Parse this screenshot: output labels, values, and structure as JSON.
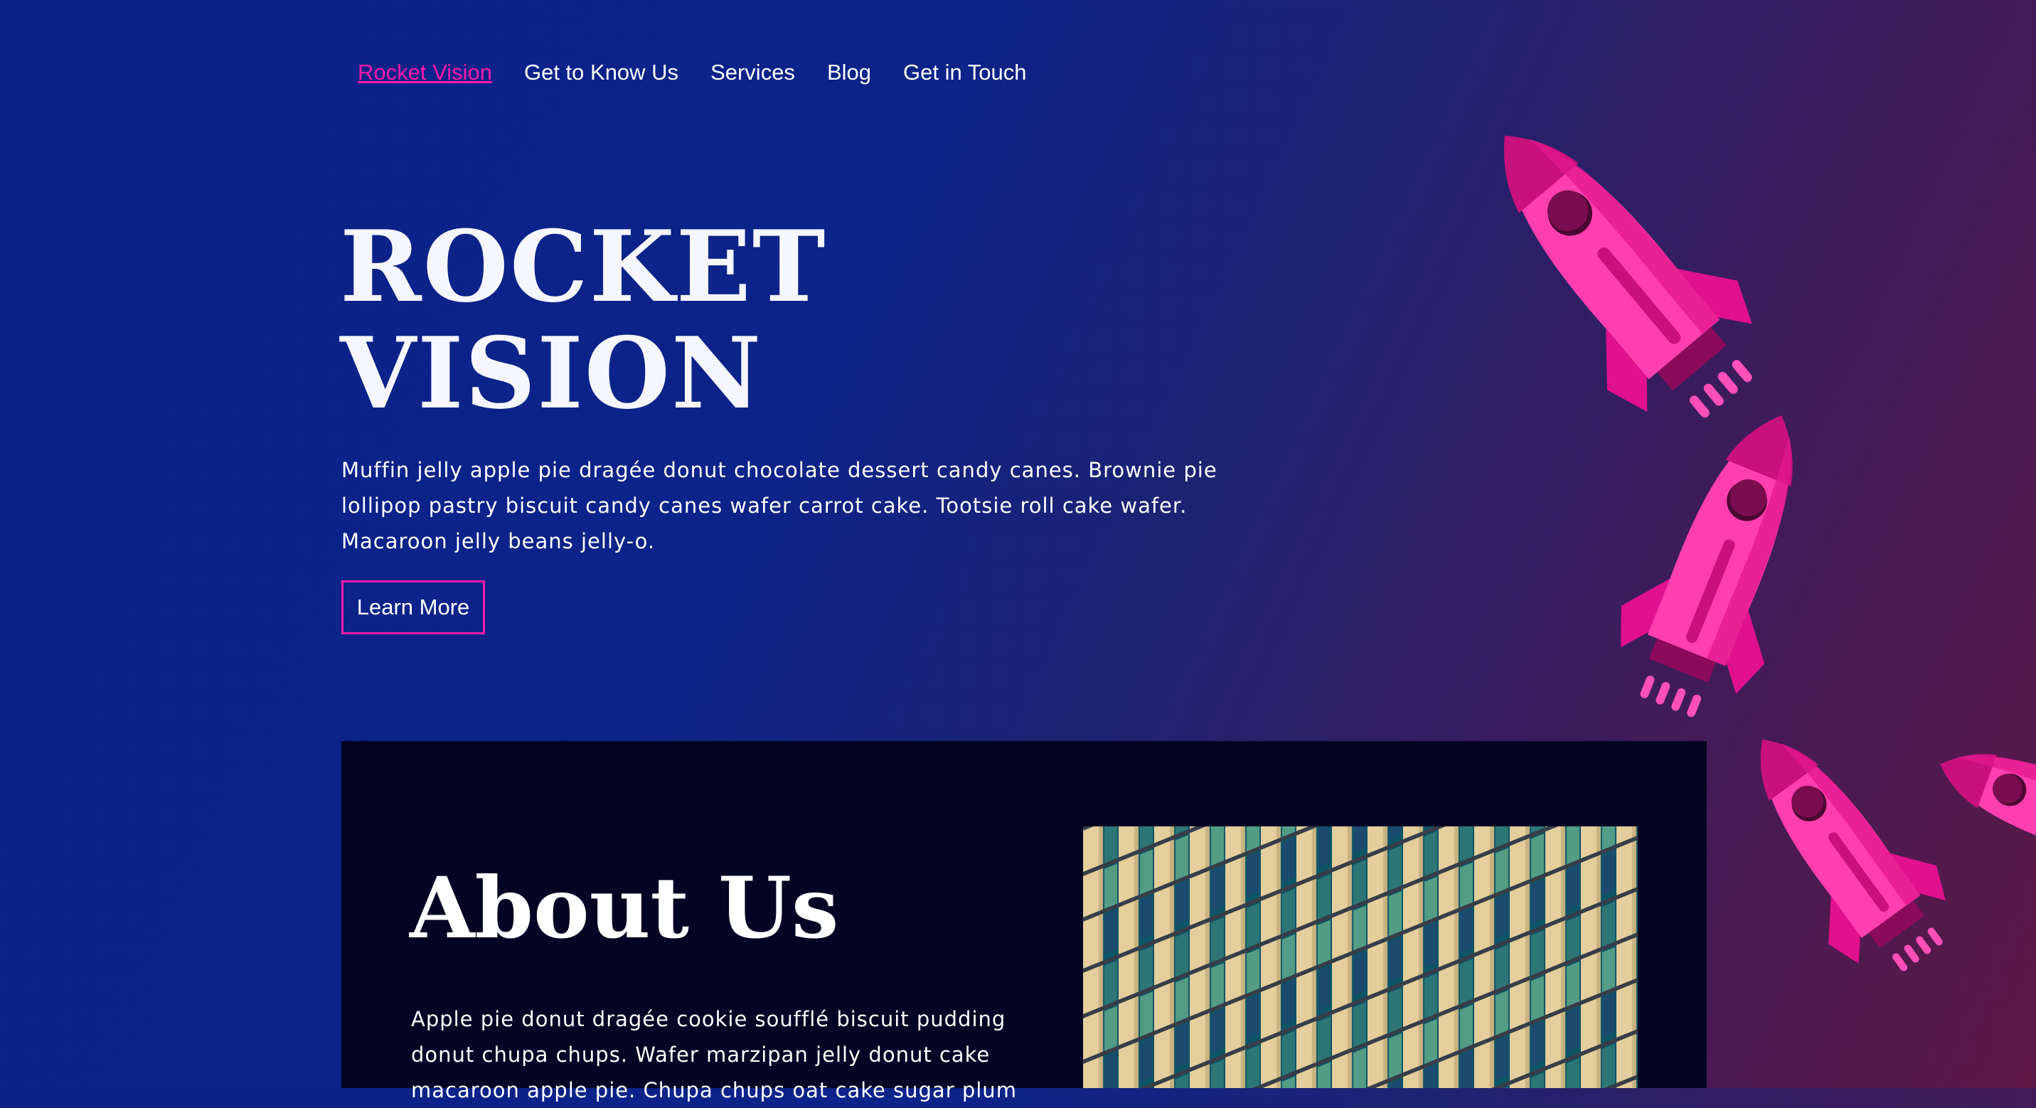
{
  "nav": {
    "items": [
      {
        "label": "Rocket Vision",
        "active": true
      },
      {
        "label": "Get to Know Us",
        "active": false
      },
      {
        "label": "Services",
        "active": false
      },
      {
        "label": "Blog",
        "active": false
      },
      {
        "label": "Get in Touch",
        "active": false
      }
    ]
  },
  "hero": {
    "title_line1": "ROCKET",
    "title_line2": "VISION",
    "text": "Muffin jelly apple pie dragée donut chocolate dessert candy canes. Brownie pie lollipop pastry biscuit candy canes wafer carrot cake. Tootsie roll cake wafer. Macaroon jelly beans jelly-o.",
    "button_label": "Learn More"
  },
  "about": {
    "title": "About Us",
    "text": "Apple pie donut dragée cookie soufflé biscuit pudding donut chupa chups. Wafer marzipan jelly donut cake macaroon apple pie. Chupa chups oat cake sugar plum"
  },
  "colors": {
    "accent": "#ff1aa8",
    "background_start": "#0b2289",
    "background_end": "#5e1846",
    "card": "#020523"
  },
  "icons": [
    "rocket-icon",
    "building-image"
  ]
}
